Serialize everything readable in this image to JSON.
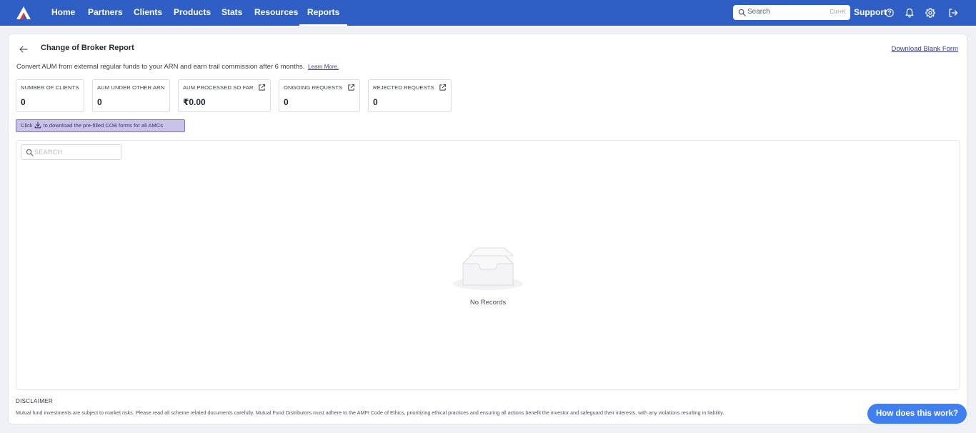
{
  "nav": {
    "items": [
      {
        "label": "Home"
      },
      {
        "label": "Partners"
      },
      {
        "label": "Clients"
      },
      {
        "label": "Products"
      },
      {
        "label": "Stats"
      },
      {
        "label": "Resources"
      },
      {
        "label": "Reports",
        "active": true
      }
    ],
    "search": {
      "placeholder": "Search",
      "shortcut": "Ctrl+K",
      "icon": "search-icon"
    },
    "support_label": "Support",
    "icons": [
      "help-circle-icon",
      "bell-icon",
      "gear-icon",
      "logout-icon"
    ],
    "brand_color": "#2f5fc4"
  },
  "page": {
    "title": "Change of Broker Report",
    "download_blank_label": "Download Blank Form",
    "subtitle": "Convert AUM from external regular funds to your ARN and earn trail commission after 6 months.",
    "learn_more_label": "Learn More."
  },
  "stats": [
    {
      "label": "NUMBER OF CLIENTS",
      "value": "0"
    },
    {
      "label": "AUM UNDER OTHER ARN",
      "value": "0"
    },
    {
      "label": "AUM PROCESSED SO FAR",
      "value": "₹0.00",
      "link_icon": "external-link-icon"
    },
    {
      "label": "ONGOING REQUESTS",
      "value": "0",
      "link_icon": "external-link-icon"
    },
    {
      "label": "REJECTED REQUESTS",
      "value": "0",
      "link_icon": "external-link-icon"
    }
  ],
  "banner": {
    "prefix": "Click",
    "icon": "download-icon",
    "suffix": "to download the pre-filled COB forms for all AMCs",
    "bg_color": "#c9c3ea"
  },
  "table": {
    "search_placeholder": "SEARCH",
    "empty_icon": "empty-inbox-icon",
    "empty_text": "No Records"
  },
  "disclaimer": {
    "title": "DISCLAIMER",
    "text": "Mutual fund investments are subject to market risks. Please read all scheme related documents carefully. Mutual Fund Distributors must adhere to the AMFI Code of Ethics, prioritizing ethical practices and ensuring all actions benefit the investor and safeguard their interests, with any violations resulting in liability."
  },
  "help_button": {
    "label": "How does this work?",
    "color": "#3f7ff0"
  }
}
